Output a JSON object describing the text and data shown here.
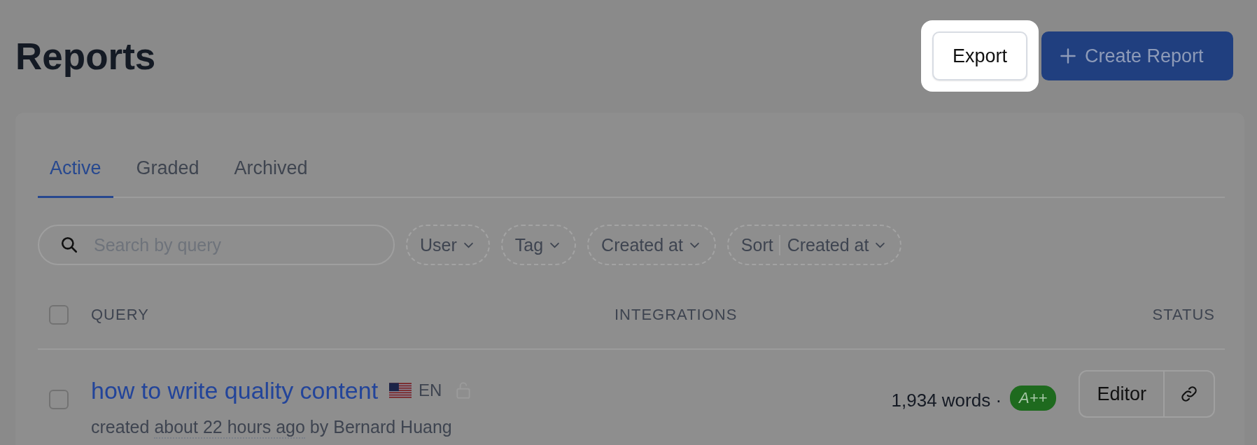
{
  "page_title": "Reports",
  "actions": [
    {
      "label": "Export",
      "kind": "secondary",
      "highlighted": true
    },
    {
      "label": "Create Report",
      "kind": "primary",
      "highlighted": false
    }
  ],
  "tabs": [
    {
      "label": "Active",
      "selected": true
    },
    {
      "label": "Graded",
      "selected": false
    },
    {
      "label": "Archived",
      "selected": false
    }
  ],
  "search": {
    "placeholder": "Search by query"
  },
  "filters": [
    {
      "label": "User"
    },
    {
      "label": "Tag"
    },
    {
      "label": "Created at"
    },
    {
      "prefix": "Sort",
      "label": "Created at"
    }
  ],
  "table": {
    "select_all_checked": false,
    "columns": [
      "QUERY",
      "INTEGRATIONS",
      "STATUS"
    ],
    "rows": [
      {
        "checked": false,
        "title": "how to write quality content",
        "language": "EN",
        "meta_before": "created",
        "meta_time": "about 22 hours ago",
        "meta_after": "by Bernard Huang",
        "words": "1,934 words ·",
        "grade": "A++",
        "open_label": "Editor"
      }
    ]
  }
}
